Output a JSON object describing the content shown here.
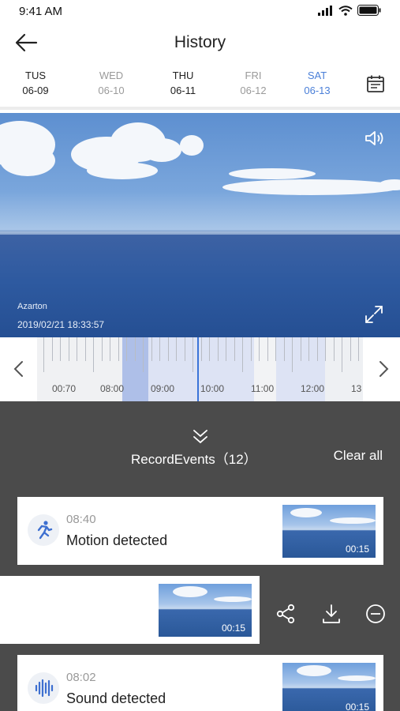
{
  "status_bar": {
    "time": "9:41 AM"
  },
  "header": {
    "title": "History"
  },
  "date_tabs": [
    {
      "dow": "TUS",
      "date": "06-09"
    },
    {
      "dow": "WED",
      "date": "06-10"
    },
    {
      "dow": "THU",
      "date": "06-11"
    },
    {
      "dow": "FRI",
      "date": "06-12"
    },
    {
      "dow": "SAT",
      "date": "06-13"
    }
  ],
  "selected_date_index": 4,
  "video": {
    "watermark_name": "Azarton",
    "watermark_time": "2019/02/21  18:33:57",
    "sound_icon": "speaker-icon",
    "expand_icon": "fullscreen-icon"
  },
  "timeline": {
    "labels": [
      "00:70",
      "08:00",
      "09:00",
      "10:00",
      "11:00",
      "12:00",
      "13"
    ]
  },
  "events_panel": {
    "title": "RecordEvents（12）",
    "clear_label": "Clear  all",
    "events": [
      {
        "time": "08:40",
        "label": "Motion detected",
        "duration": "00:15",
        "icon": "running-person-icon"
      },
      {
        "time": "",
        "label": "",
        "duration": "00:15",
        "icon": ""
      },
      {
        "time": "08:02",
        "label": "Sound detected",
        "duration": "00:15",
        "icon": "sound-wave-icon"
      }
    ],
    "swipe_actions": [
      "share-icon",
      "download-icon",
      "remove-icon"
    ]
  },
  "colors": {
    "accent": "#4a7fd8",
    "panel": "#4b4b4b",
    "highlight": "#aebfe8"
  }
}
